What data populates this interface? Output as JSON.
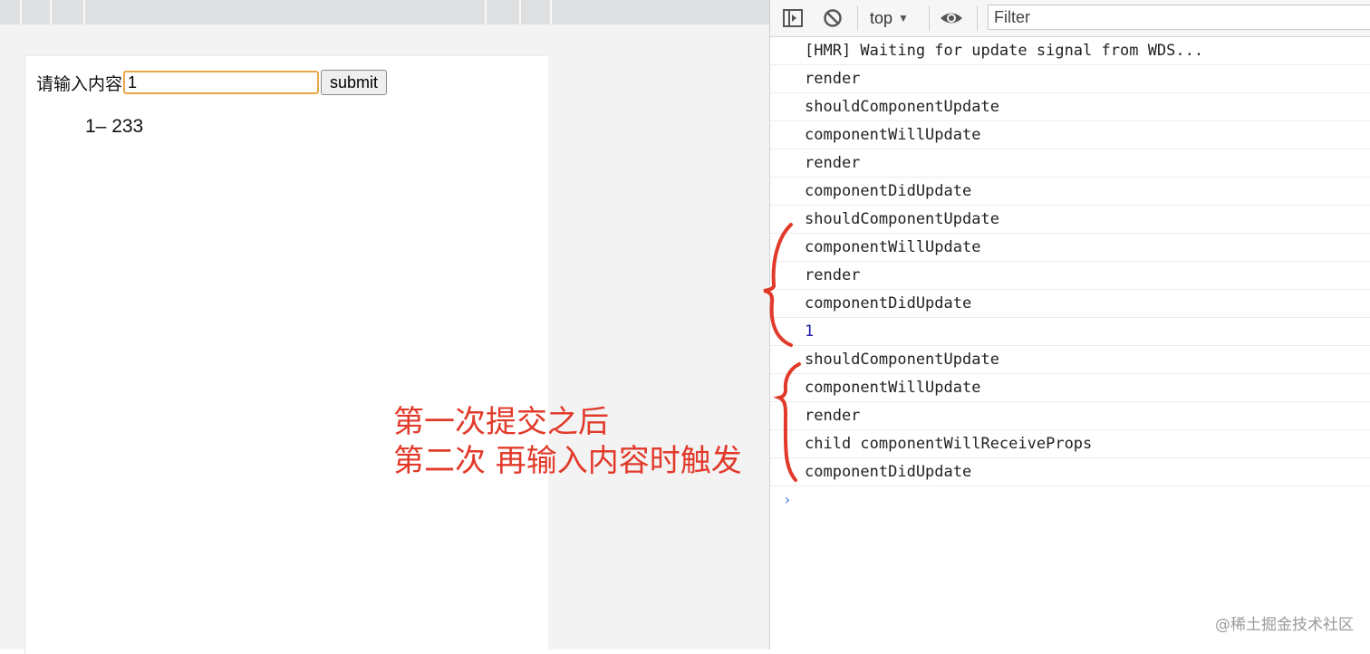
{
  "page": {
    "form": {
      "label": "请输入内容",
      "input_value": "1",
      "submit_label": "submit"
    },
    "list_items": [
      "1– 233"
    ]
  },
  "devtools": {
    "context": "top",
    "filter_placeholder": "Filter",
    "console_lines": [
      "[HMR] Waiting for update signal from WDS...",
      "render",
      "shouldComponentUpdate",
      "componentWillUpdate",
      "render",
      "componentDidUpdate",
      "shouldComponentUpdate",
      "componentWillUpdate",
      "render",
      "componentDidUpdate",
      "1",
      "shouldComponentUpdate",
      "componentWillUpdate",
      "render",
      "child componentWillReceiveProps",
      "componentDidUpdate"
    ],
    "prompt_symbol": "›"
  },
  "annotation": {
    "line1": "第一次提交之后",
    "line2": "第二次 再输入内容时触发",
    "color": "#e23a2a"
  },
  "watermark": "@稀土掘金技术社区"
}
